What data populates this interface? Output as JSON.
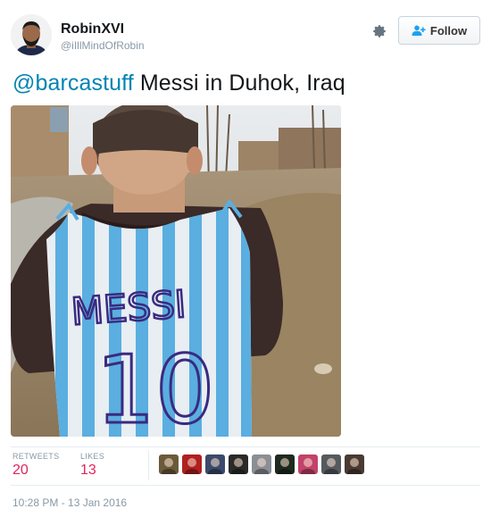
{
  "user": {
    "display_name": "RobinXVI",
    "screen_name": "@iIllMindOfRobin"
  },
  "follow_button": {
    "label": "Follow",
    "icon": "add-user-icon"
  },
  "settings": {
    "icon": "gear-icon"
  },
  "tweet": {
    "mention": "@barcastuff",
    "text": " Messi in Duhok, Iraq"
  },
  "photo": {
    "shirt_name": "MESSI",
    "shirt_number": "10"
  },
  "stats": {
    "retweets_label": "RETWEETS",
    "retweets_count": "20",
    "likes_label": "LIKES",
    "likes_count": "13"
  },
  "liker_avatar_colors": [
    "#6b5a3a",
    "#b02020",
    "#3b4a6b",
    "#2a2a2a",
    "#8a8f96",
    "#1f2a1f",
    "#c2426a",
    "#555a5f",
    "#4a3b32"
  ],
  "timestamp": "10:28 PM - 13 Jan 2016",
  "colors": {
    "mention": "#0084b4",
    "count": "#e0245e",
    "muted": "#8899a6"
  }
}
